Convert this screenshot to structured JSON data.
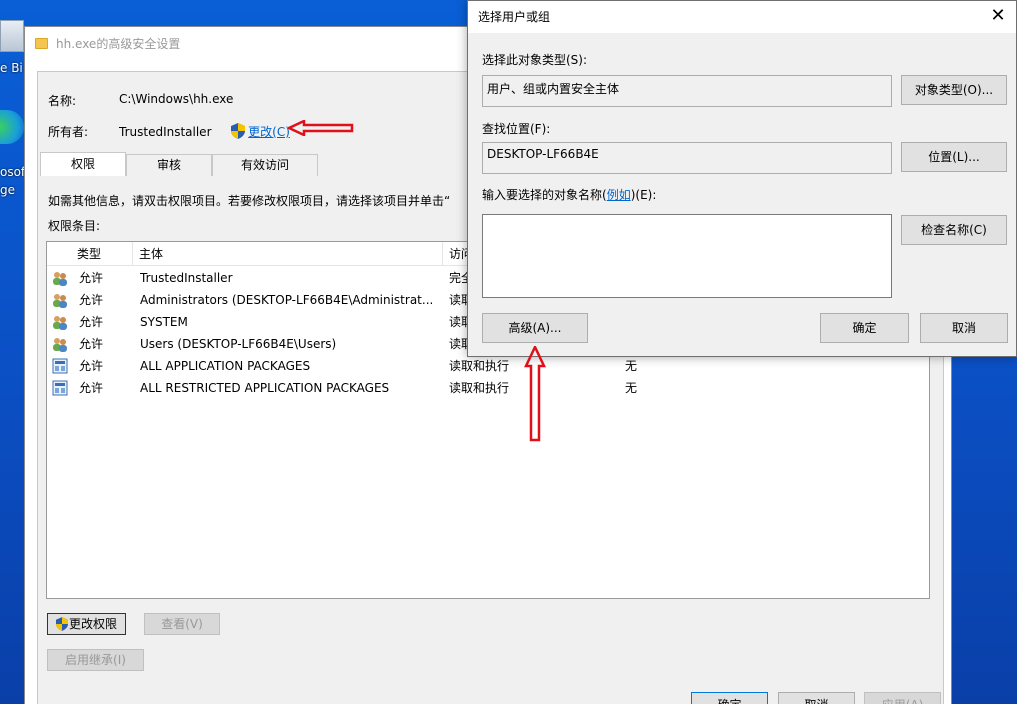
{
  "desktop": {
    "icon1_label": "e Bi",
    "icon2_label_line1": "osof",
    "icon2_label_line2": "ge"
  },
  "back_window": {
    "title": "hh.exe的高级安全设置",
    "name_label": "名称:",
    "name_value": "C:\\Windows\\hh.exe",
    "owner_label": "所有者:",
    "owner_value": "TrustedInstaller",
    "change_link": "更改(C)",
    "tabs": [
      {
        "label": "权限"
      },
      {
        "label": "审核"
      },
      {
        "label": "有效访问"
      }
    ],
    "info_text": "如需其他信息，请双击权限项目。若要修改权限项目，请选择该项目并单击“",
    "entries_label": "权限条目:",
    "table": {
      "headers": [
        "类型",
        "主体",
        "访问"
      ],
      "rows": [
        {
          "type": "允许",
          "principal": "TrustedInstaller",
          "access": "完全",
          "inherit": "",
          "icon": "users-icon"
        },
        {
          "type": "允许",
          "principal": "Administrators (DESKTOP-LF66B4E\\Administrat...",
          "access": "读取",
          "inherit": "",
          "icon": "users-icon"
        },
        {
          "type": "允许",
          "principal": "SYSTEM",
          "access": "读取",
          "inherit": "",
          "icon": "users-icon"
        },
        {
          "type": "允许",
          "principal": "Users (DESKTOP-LF66B4E\\Users)",
          "access": "读取",
          "inherit": "",
          "icon": "users-icon"
        },
        {
          "type": "允许",
          "principal": "ALL APPLICATION PACKAGES",
          "access": "读取和执行",
          "inherit": "无",
          "icon": "packages-icon"
        },
        {
          "type": "允许",
          "principal": "ALL RESTRICTED APPLICATION PACKAGES",
          "access": "读取和执行",
          "inherit": "无",
          "icon": "packages-icon"
        }
      ]
    },
    "btn_change_perms": "更改权限",
    "btn_view": "查看(V)",
    "btn_enable_inherit": "启用继承(I)",
    "btn_ok": "确定",
    "btn_cancel": "取消",
    "btn_apply": "应用(A)"
  },
  "dialog": {
    "title": "选择用户或组",
    "object_type_label": "选择此对象类型(S):",
    "object_type_value": "用户、组或内置安全主体",
    "object_type_btn": "对象类型(O)...",
    "location_label": "查找位置(F):",
    "location_value": "DESKTOP-LF66B4E",
    "location_btn": "位置(L)...",
    "enter_names_label_pre": "输入要选择的对象名称(",
    "enter_names_link": "例如",
    "enter_names_label_post": ")(E):",
    "check_names_btn": "检查名称(C)",
    "advanced_btn": "高级(A)...",
    "ok_btn": "确定",
    "cancel_btn": "取消"
  },
  "colors": {
    "desktop_blue": "#0b4fc4",
    "link_blue": "#0066cc",
    "annotation_red": "#e0101a"
  }
}
